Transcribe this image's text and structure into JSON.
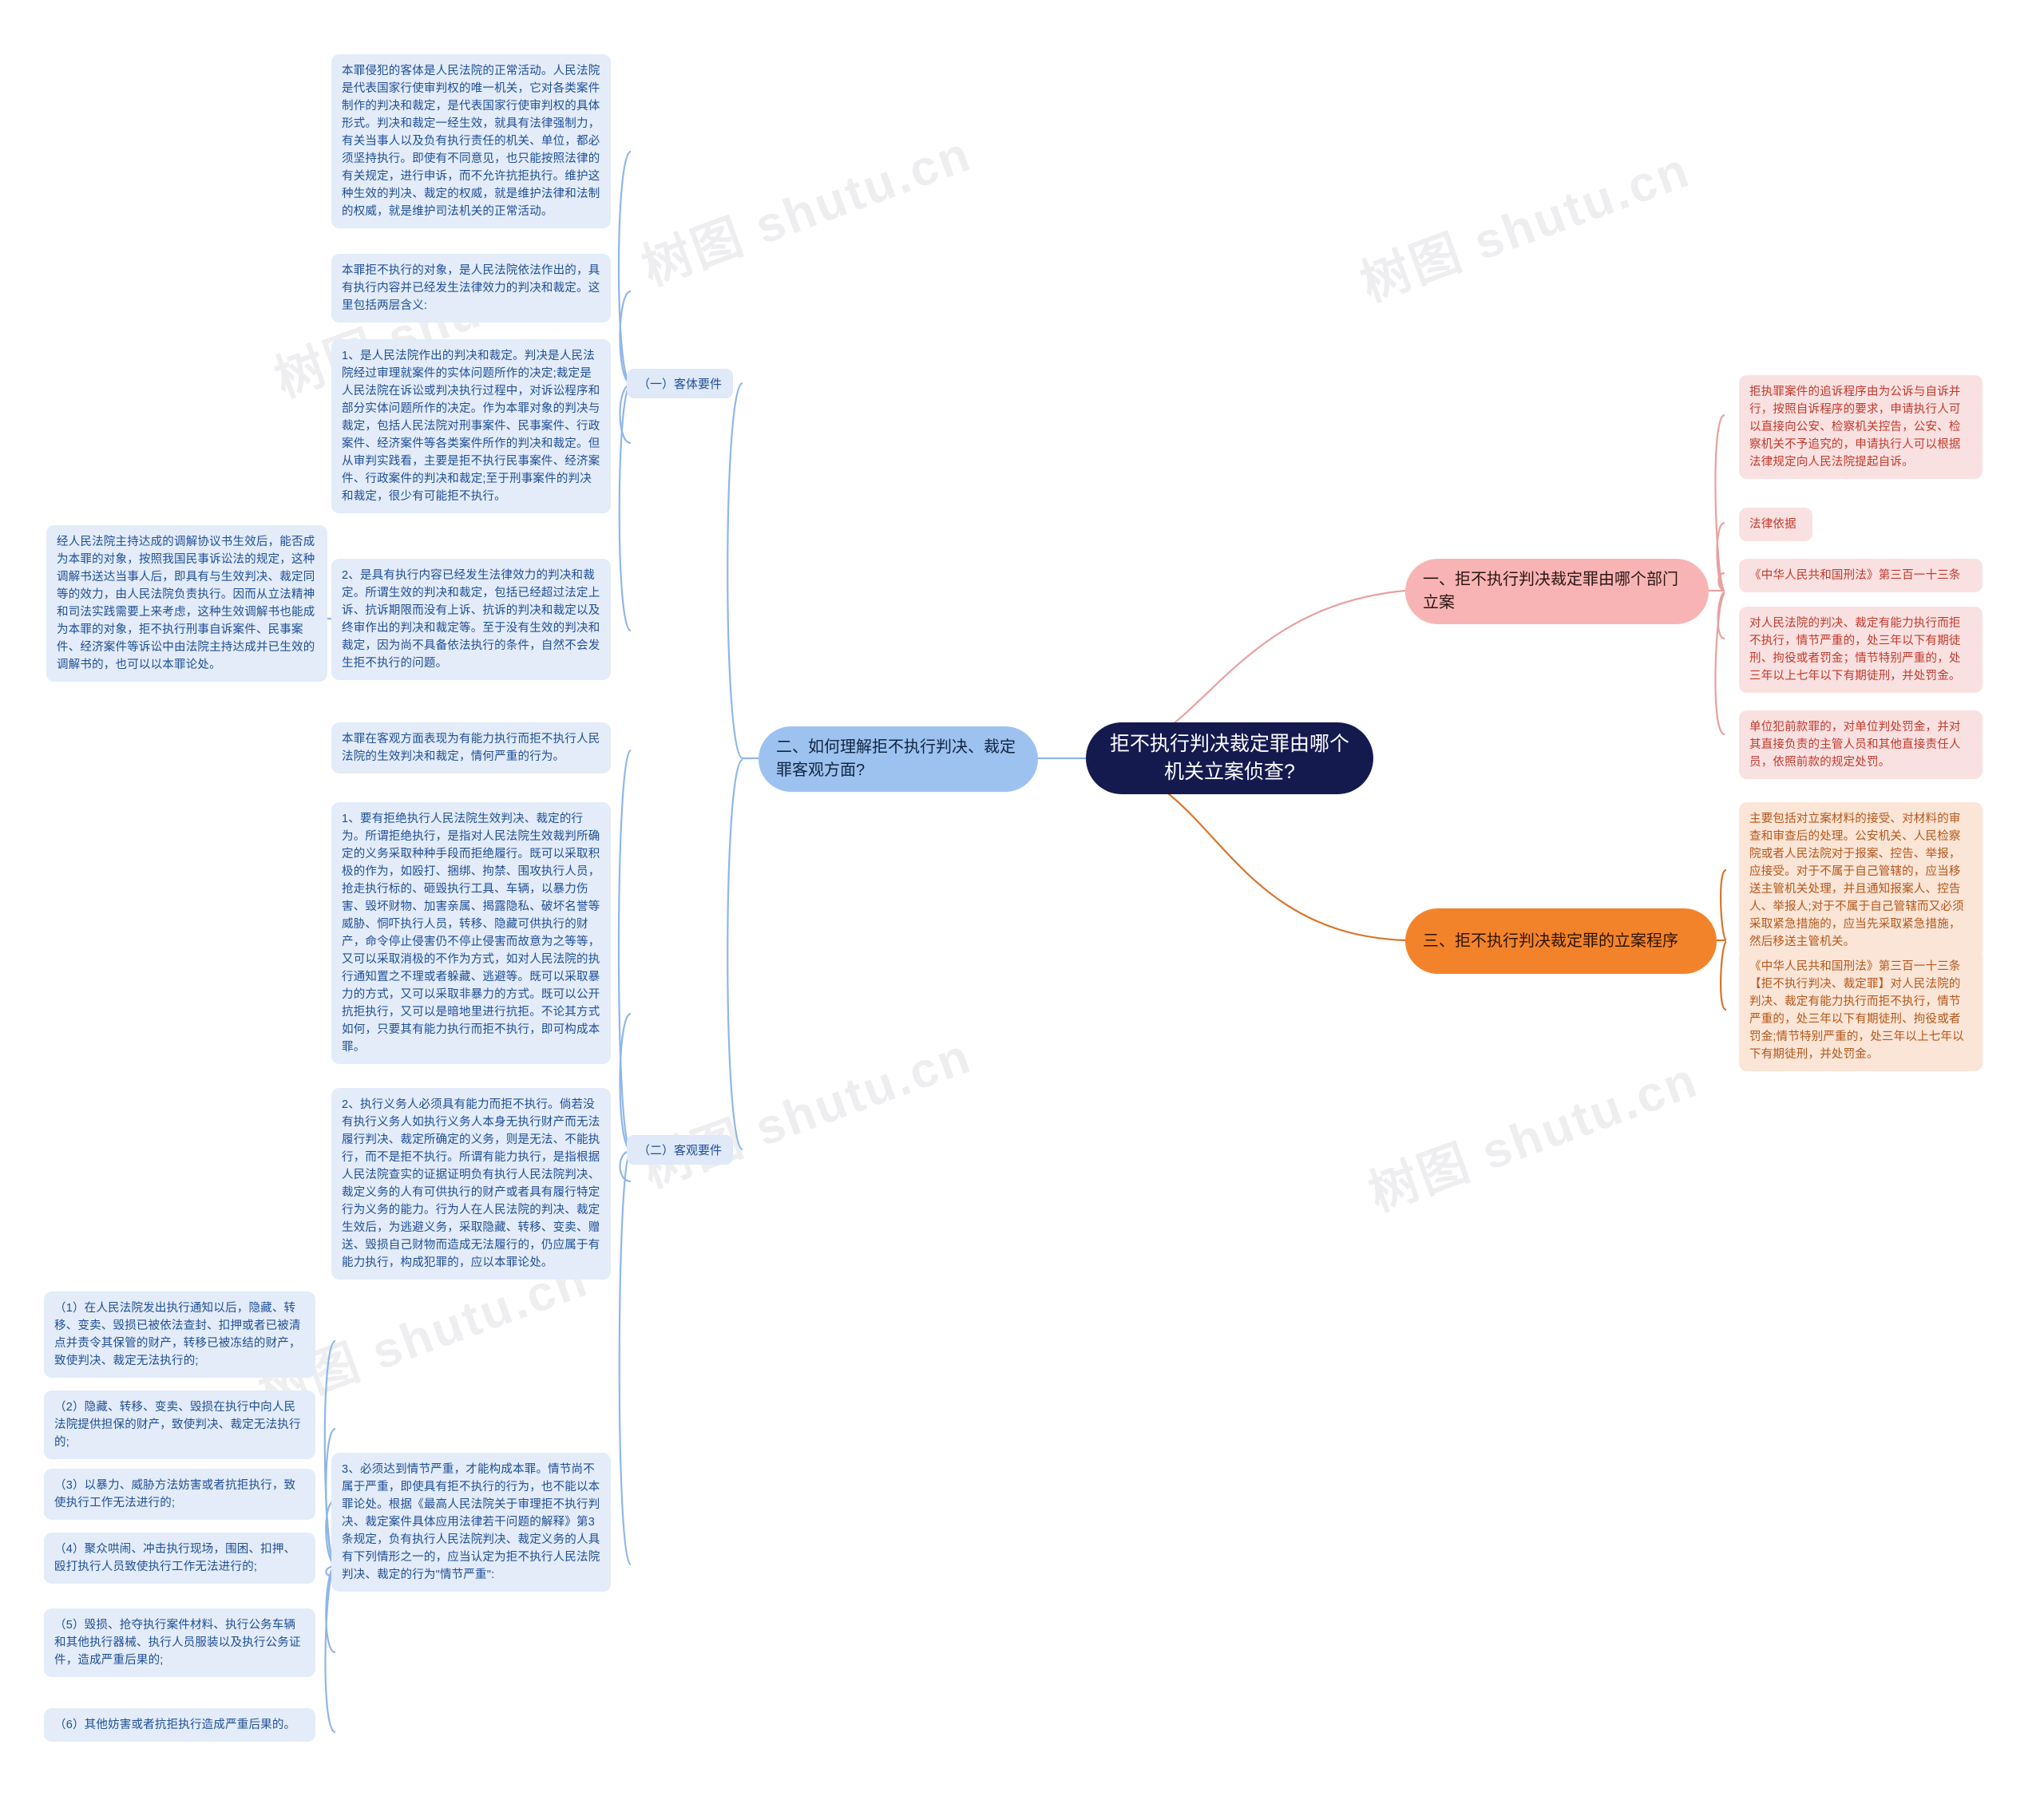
{
  "center": {
    "title": "拒不执行判决裁定罪由哪个机关立案侦查?"
  },
  "watermarks": [
    "树图 shutu.cn",
    "树图 shutu.cn",
    "树图 shutu.cn",
    "树图 shutu.cn",
    "树图 shutu.cn",
    "树图 shutu.cn"
  ],
  "branches": {
    "one": "一、拒不执行判决裁定罪由哪个部门立案",
    "two": "二、如何理解拒不执行判决、裁定罪客观方面?",
    "three": "三、拒不执行判决裁定罪的立案程序"
  },
  "labels": {
    "objective_subject": "（一）客体要件",
    "objective_aspect": "（二）客观要件"
  },
  "branch_one_nodes": [
    "拒执罪案件的追诉程序由为公诉与自诉并行，按照自诉程序的要求，申请执行人可以直接向公安、检察机关控告，公安、检察机关不予追究的，申请执行人可以根据法律规定向人民法院提起自诉。",
    "法律依据",
    "《中华人民共和国刑法》第三百一十三条",
    "对人民法院的判决、裁定有能力执行而拒不执行，情节严重的，处三年以下有期徒刑、拘役或者罚金；情节特别严重的，处三年以上七年以下有期徒刑，并处罚金。",
    "单位犯前款罪的，对单位判处罚金，并对其直接负责的主管人员和其他直接责任人员，依照前款的规定处罚。"
  ],
  "branch_three_nodes": [
    "主要包括对立案材料的接受、对材料的审查和审查后的处理。公安机关、人民检察院或者人民法院对于报案、控告、举报，应接受。对于不属于自己管辖的，应当移送主管机关处理，并且通知报案人、控告人、举报人;对于不属于自己管辖而又必须采取紧急措施的，应当先采取紧急措施，然后移送主管机关。",
    "《中华人民共和国刑法》第三百一十三条【拒不执行判决、裁定罪】对人民法院的判决、裁定有能力执行而拒不执行，情节严重的，处三年以下有期徒刑、拘役或者罚金;情节特别严重的，处三年以上七年以下有期徒刑，并处罚金。"
  ],
  "subject_nodes": [
    "本罪侵犯的客体是人民法院的正常活动。人民法院是代表国家行使审判权的唯一机关，它对各类案件制作的判决和裁定，是代表国家行使审判权的具体形式。判决和裁定一经生效，就具有法律强制力，有关当事人以及负有执行责任的机关、单位，都必须坚持执行。即使有不同意见，也只能按照法律的有关规定，进行申诉，而不允许抗拒执行。维护这种生效的判决、裁定的权威，就是维护法律和法制的权威，就是维护司法机关的正常活动。",
    "本罪拒不执行的对象，是人民法院依法作出的，具有执行内容并已经发生法律效力的判决和裁定。这里包括两层含义:",
    "1、是人民法院作出的判决和裁定。判决是人民法院经过审理就案件的实体问题所作的决定;裁定是人民法院在诉讼或判决执行过程中，对诉讼程序和部分实体问题所作的决定。作为本罪对象的判决与裁定，包括人民法院对刑事案件、民事案件、行政案件、经济案件等各类案件所作的判决和裁定。但从审判实践看，主要是拒不执行民事案件、经济案件、行政案件的判决和裁定;至于刑事案件的判决和裁定，很少有可能拒不执行。",
    "2、是具有执行内容已经发生法律效力的判决和裁定。所谓生效的判决和裁定，包括已经超过法定上诉、抗诉期限而没有上诉、抗诉的判决和裁定以及终审作出的判决和裁定等。至于没有生效的判决和裁定，因为尚不具备依法执行的条件，自然不会发生拒不执行的问题。"
  ],
  "mediation_node": "经人民法院主持达成的调解协议书生效后，能否成为本罪的对象，按照我国民事诉讼法的规定，这种调解书送达当事人后，即具有与生效判决、裁定同等的效力，由人民法院负责执行。因而从立法精神和司法实践需要上来考虑，这种生效调解书也能成为本罪的对象，拒不执行刑事自诉案件、民事案件、经济案件等诉讼中由法院主持达成并已生效的调解书的，也可以以本罪论处。",
  "aspect_nodes": [
    "本罪在客观方面表现为有能力执行而拒不执行人民法院的生效判决和裁定，情何严重的行为。",
    "1、要有拒绝执行人民法院生效判决、裁定的行为。所谓拒绝执行，是指对人民法院生效裁判所确定的义务采取种种手段而拒绝履行。既可以采取积极的作为，如殴打、捆绑、拘禁、围攻执行人员，抢走执行标的、砸毁执行工具、车辆，以暴力伤害、毁坏财物、加害亲属、揭露隐私、破坏名誉等威胁、恫吓执行人员，转移、隐藏可供执行的财产，命令停止侵害仍不停止侵害而故意为之等等，又可以采取消极的不作为方式，如对人民法院的执行通知置之不理或者躲藏、逃避等。既可以采取暴力的方式，又可以采取非暴力的方式。既可以公开抗拒执行，又可以是暗地里进行抗拒。不论其方式如何，只要其有能力执行而拒不执行，即可构成本罪。",
    "2、执行义务人必须具有能力而拒不执行。倘若没有执行义务人如执行义务人本身无执行财产而无法履行判决、裁定所确定的义务，则是无法、不能执行，而不是拒不执行。所谓有能力执行，是指根据人民法院查实的证据证明负有执行人民法院判决、裁定义务的人有可供执行的财产或者具有履行特定行为义务的能力。行为人在人民法院的判决、裁定生效后，为逃避义务，采取隐藏、转移、变卖、赠送、毁损自己财物而造成无法履行的，仍应属于有能力执行，构成犯罪的，应以本罪论处。",
    "3、必须达到情节严重，才能构成本罪。情节尚不属于严重，即使具有拒不执行的行为，也不能以本罪论处。根据《最高人民法院关于审理拒不执行判决、裁定案件具体应用法律若干问题的解释》第3条规定，负有执行人民法院判决、裁定义务的人具有下列情形之一的，应当认定为拒不执行人民法院判决、裁定的行为\"情节严重\":"
  ],
  "severe_items": [
    "（1）在人民法院发出执行通知以后，隐藏、转移、变卖、毁损已被依法查封、扣押或者已被清点并责令其保管的财产，转移已被冻结的财产，致使判决、裁定无法执行的;",
    "（2）隐藏、转移、变卖、毁损在执行中向人民法院提供担保的财产，致使判决、裁定无法执行的;",
    "（3）以暴力、威胁方法妨害或者抗拒执行，致使执行工作无法进行的;",
    "（4）聚众哄闹、冲击执行现场，围困、扣押、殴打执行人员致使执行工作无法进行的;",
    "（5）毁损、抢夺执行案件材料、执行公务车辆和其他执行器械、执行人员服装以及执行公务证件，造成严重后果的;",
    "（6）其他妨害或者抗拒执行造成严重后果的。"
  ],
  "colors": {
    "center_bg": "#141a4e",
    "blue_pill": "#9dc2f0",
    "pink_pill": "#f8b4b4",
    "orange_pill": "#f3832a",
    "blue_node": "#e3ecf8",
    "red_node": "#fae1e1",
    "orange_node": "#fae5d6"
  }
}
